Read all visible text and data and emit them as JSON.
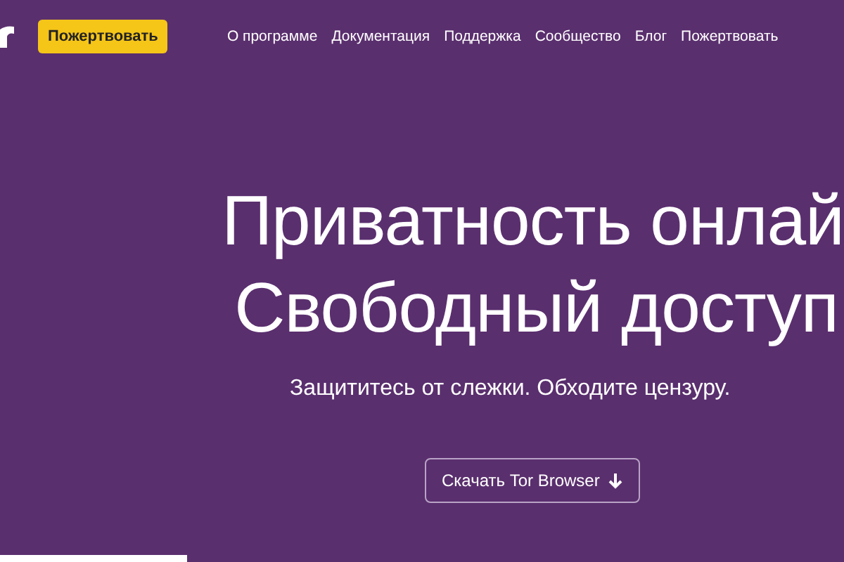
{
  "header": {
    "donate_button": "Пожертвовать",
    "nav": [
      {
        "label": "О программе"
      },
      {
        "label": "Документация"
      },
      {
        "label": "Поддержка"
      },
      {
        "label": "Сообщество"
      },
      {
        "label": "Блог"
      },
      {
        "label": "Пожертвовать"
      }
    ]
  },
  "hero": {
    "headline": [
      "Приватность онлай",
      "Свободный доступ"
    ],
    "subtitle": "Защититесь от слежки. Обходите цензуру.",
    "download_button": "Скачать Tor Browser"
  }
}
